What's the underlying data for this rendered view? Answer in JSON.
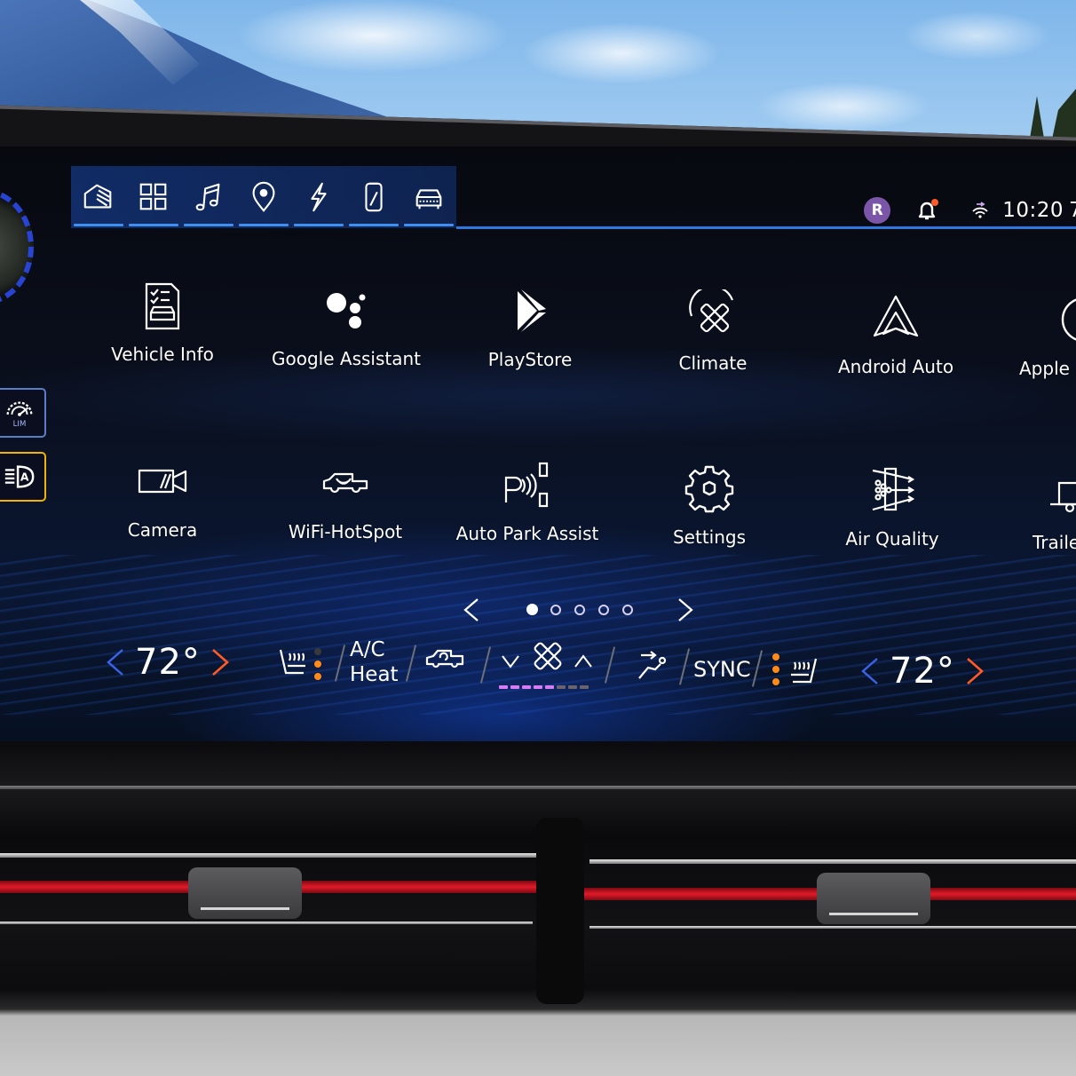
{
  "nav": {
    "tabs": [
      {
        "id": "home",
        "icon": "home-icon"
      },
      {
        "id": "apps",
        "icon": "app-grid-icon"
      },
      {
        "id": "audio",
        "icon": "music-note-icon"
      },
      {
        "id": "navigation",
        "icon": "map-pin-icon"
      },
      {
        "id": "energy",
        "icon": "lightning-bolt-icon"
      },
      {
        "id": "phone",
        "icon": "phone-icon"
      },
      {
        "id": "vehicle",
        "icon": "car-icon"
      }
    ]
  },
  "status": {
    "profile_initial": "R",
    "profile_color": "#7b56a8",
    "notification_dot_color": "#ff5a2a",
    "time": "10:20",
    "next_item_partial": "7"
  },
  "side_rail": {
    "speed_limiter_label": "LIM",
    "speed_limiter_border": "#5a7fc4",
    "auto_headlamp_label": "A",
    "auto_headlamp_border": "#f2b400"
  },
  "apps": [
    {
      "label": "Vehicle Info",
      "icon": "vehicle-info-icon"
    },
    {
      "label": "Google Assistant",
      "icon": "google-assistant-icon"
    },
    {
      "label": "PlayStore",
      "icon": "playstore-icon"
    },
    {
      "label": "Climate",
      "icon": "climate-fan-icon"
    },
    {
      "label": "Android Auto",
      "icon": "android-auto-icon"
    },
    {
      "label": "Apple CarPlay",
      "label_visible": "Apple (",
      "icon": "apple-carplay-icon"
    },
    {
      "label": "Camera",
      "icon": "camera-icon"
    },
    {
      "label": "WiFi-HotSpot",
      "icon": "wifi-hotspot-icon"
    },
    {
      "label": "Auto Park Assist",
      "icon": "park-assist-icon"
    },
    {
      "label": "Settings",
      "icon": "gear-icon"
    },
    {
      "label": "Air Quality",
      "icon": "air-quality-icon"
    },
    {
      "label": "Trailering",
      "label_visible": "Traile",
      "icon": "trailer-icon"
    }
  ],
  "pager": {
    "pages": 5,
    "current_page": 1
  },
  "climate": {
    "driver_temp": "72°",
    "passenger_temp": "72°",
    "ac_line1": "A/C",
    "ac_line2": "Heat",
    "sync_label": "SYNC",
    "fan_level": 5,
    "fan_level_max": 8,
    "driver_seat_heat_level": 2,
    "passenger_seat_heat_level": 3,
    "seat_heat_max": 3,
    "colors": {
      "temp_down": "#3a63e8",
      "temp_up": "#ff5a24",
      "heat_dot_on": "#ff8a1a",
      "heat_dot_off": "#3a3a3a",
      "fan_on": "#d87cf5",
      "fan_off": "#6b6470"
    }
  }
}
